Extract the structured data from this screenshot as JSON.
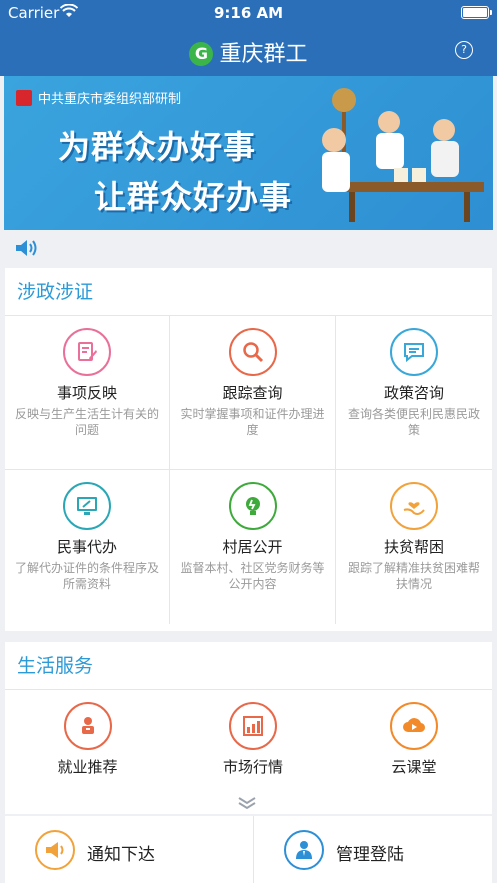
{
  "status": {
    "carrier": "Carrier",
    "time": "9:16 AM"
  },
  "nav": {
    "title": "重庆群工",
    "logo_letter": "G",
    "help": "?"
  },
  "banner": {
    "org": "中共重庆市委组织部研制",
    "line1": "为群众办好事",
    "line2": "让群众好办事"
  },
  "section1": {
    "title": "涉政涉证",
    "items": [
      {
        "title": "事项反映",
        "desc": "反映与生产生活生计有关的问题",
        "icon": "edit-icon",
        "color": "#e9709a"
      },
      {
        "title": "跟踪查询",
        "desc": "实时掌握事项和证件办理进度",
        "icon": "search-icon",
        "color": "#e8684a"
      },
      {
        "title": "政策咨询",
        "desc": "查询各类便民利民惠民政策",
        "icon": "chat-icon",
        "color": "#3aa7d9"
      },
      {
        "title": "民事代办",
        "desc": "了解代办证件的条件程序及所需资料",
        "icon": "monitor-icon",
        "color": "#2aa7b6"
      },
      {
        "title": "村居公开",
        "desc": "监督本村、社区党务财务等公开内容",
        "icon": "bulb-icon",
        "color": "#3faa3c"
      },
      {
        "title": "扶贫帮困",
        "desc": "跟踪了解精准扶贫困难帮扶情况",
        "icon": "hand-heart-icon",
        "color": "#f1a23b"
      }
    ]
  },
  "section2": {
    "title": "生活服务",
    "items": [
      {
        "title": "就业推荐",
        "icon": "job-icon",
        "color": "#e8684a"
      },
      {
        "title": "市场行情",
        "icon": "chart-icon",
        "color": "#e8684a"
      },
      {
        "title": "云课堂",
        "icon": "cloud-play-icon",
        "color": "#f28a2a"
      }
    ]
  },
  "bottom": {
    "notify": "通知下达",
    "admin": "管理登陆"
  }
}
